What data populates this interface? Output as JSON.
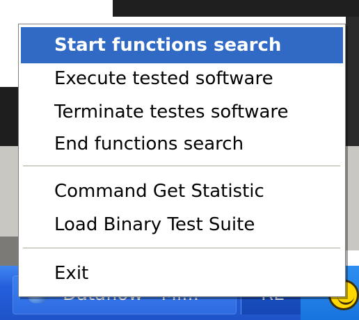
{
  "taskbar": {
    "task_label": "Dataflow - Mi...",
    "tray_label": "RL"
  },
  "menu": {
    "items": [
      {
        "label": "Start functions search",
        "selected": true
      },
      {
        "label": "Execute tested software"
      },
      {
        "label": "Terminate testes software"
      },
      {
        "label": "End functions search"
      },
      {
        "label": "Command Get Statistic"
      },
      {
        "label": "Load Binary Test Suite"
      },
      {
        "label": "Exit"
      }
    ]
  },
  "colors": {
    "selection": "#316ac5",
    "taskbar": "#245edb",
    "smiley": "#ffd800"
  },
  "icons": {
    "task": "dataflow-app-icon",
    "tray": "smiley-icon"
  }
}
